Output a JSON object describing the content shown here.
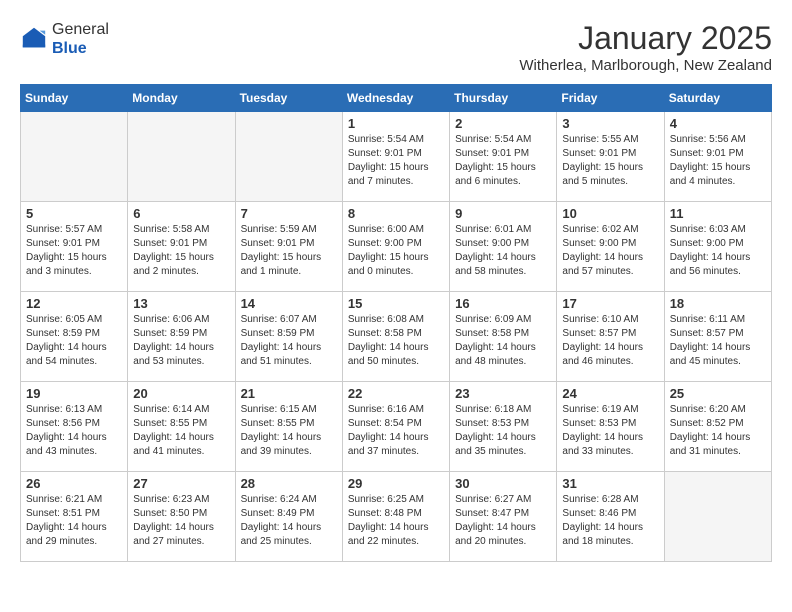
{
  "header": {
    "logo_general": "General",
    "logo_blue": "Blue",
    "month_title": "January 2025",
    "location": "Witherlea, Marlborough, New Zealand"
  },
  "days_of_week": [
    "Sunday",
    "Monday",
    "Tuesday",
    "Wednesday",
    "Thursday",
    "Friday",
    "Saturday"
  ],
  "weeks": [
    [
      {
        "day": "",
        "info": ""
      },
      {
        "day": "",
        "info": ""
      },
      {
        "day": "",
        "info": ""
      },
      {
        "day": "1",
        "info": "Sunrise: 5:54 AM\nSunset: 9:01 PM\nDaylight: 15 hours\nand 7 minutes."
      },
      {
        "day": "2",
        "info": "Sunrise: 5:54 AM\nSunset: 9:01 PM\nDaylight: 15 hours\nand 6 minutes."
      },
      {
        "day": "3",
        "info": "Sunrise: 5:55 AM\nSunset: 9:01 PM\nDaylight: 15 hours\nand 5 minutes."
      },
      {
        "day": "4",
        "info": "Sunrise: 5:56 AM\nSunset: 9:01 PM\nDaylight: 15 hours\nand 4 minutes."
      }
    ],
    [
      {
        "day": "5",
        "info": "Sunrise: 5:57 AM\nSunset: 9:01 PM\nDaylight: 15 hours\nand 3 minutes."
      },
      {
        "day": "6",
        "info": "Sunrise: 5:58 AM\nSunset: 9:01 PM\nDaylight: 15 hours\nand 2 minutes."
      },
      {
        "day": "7",
        "info": "Sunrise: 5:59 AM\nSunset: 9:01 PM\nDaylight: 15 hours\nand 1 minute."
      },
      {
        "day": "8",
        "info": "Sunrise: 6:00 AM\nSunset: 9:00 PM\nDaylight: 15 hours\nand 0 minutes."
      },
      {
        "day": "9",
        "info": "Sunrise: 6:01 AM\nSunset: 9:00 PM\nDaylight: 14 hours\nand 58 minutes."
      },
      {
        "day": "10",
        "info": "Sunrise: 6:02 AM\nSunset: 9:00 PM\nDaylight: 14 hours\nand 57 minutes."
      },
      {
        "day": "11",
        "info": "Sunrise: 6:03 AM\nSunset: 9:00 PM\nDaylight: 14 hours\nand 56 minutes."
      }
    ],
    [
      {
        "day": "12",
        "info": "Sunrise: 6:05 AM\nSunset: 8:59 PM\nDaylight: 14 hours\nand 54 minutes."
      },
      {
        "day": "13",
        "info": "Sunrise: 6:06 AM\nSunset: 8:59 PM\nDaylight: 14 hours\nand 53 minutes."
      },
      {
        "day": "14",
        "info": "Sunrise: 6:07 AM\nSunset: 8:59 PM\nDaylight: 14 hours\nand 51 minutes."
      },
      {
        "day": "15",
        "info": "Sunrise: 6:08 AM\nSunset: 8:58 PM\nDaylight: 14 hours\nand 50 minutes."
      },
      {
        "day": "16",
        "info": "Sunrise: 6:09 AM\nSunset: 8:58 PM\nDaylight: 14 hours\nand 48 minutes."
      },
      {
        "day": "17",
        "info": "Sunrise: 6:10 AM\nSunset: 8:57 PM\nDaylight: 14 hours\nand 46 minutes."
      },
      {
        "day": "18",
        "info": "Sunrise: 6:11 AM\nSunset: 8:57 PM\nDaylight: 14 hours\nand 45 minutes."
      }
    ],
    [
      {
        "day": "19",
        "info": "Sunrise: 6:13 AM\nSunset: 8:56 PM\nDaylight: 14 hours\nand 43 minutes."
      },
      {
        "day": "20",
        "info": "Sunrise: 6:14 AM\nSunset: 8:55 PM\nDaylight: 14 hours\nand 41 minutes."
      },
      {
        "day": "21",
        "info": "Sunrise: 6:15 AM\nSunset: 8:55 PM\nDaylight: 14 hours\nand 39 minutes."
      },
      {
        "day": "22",
        "info": "Sunrise: 6:16 AM\nSunset: 8:54 PM\nDaylight: 14 hours\nand 37 minutes."
      },
      {
        "day": "23",
        "info": "Sunrise: 6:18 AM\nSunset: 8:53 PM\nDaylight: 14 hours\nand 35 minutes."
      },
      {
        "day": "24",
        "info": "Sunrise: 6:19 AM\nSunset: 8:53 PM\nDaylight: 14 hours\nand 33 minutes."
      },
      {
        "day": "25",
        "info": "Sunrise: 6:20 AM\nSunset: 8:52 PM\nDaylight: 14 hours\nand 31 minutes."
      }
    ],
    [
      {
        "day": "26",
        "info": "Sunrise: 6:21 AM\nSunset: 8:51 PM\nDaylight: 14 hours\nand 29 minutes."
      },
      {
        "day": "27",
        "info": "Sunrise: 6:23 AM\nSunset: 8:50 PM\nDaylight: 14 hours\nand 27 minutes."
      },
      {
        "day": "28",
        "info": "Sunrise: 6:24 AM\nSunset: 8:49 PM\nDaylight: 14 hours\nand 25 minutes."
      },
      {
        "day": "29",
        "info": "Sunrise: 6:25 AM\nSunset: 8:48 PM\nDaylight: 14 hours\nand 22 minutes."
      },
      {
        "day": "30",
        "info": "Sunrise: 6:27 AM\nSunset: 8:47 PM\nDaylight: 14 hours\nand 20 minutes."
      },
      {
        "day": "31",
        "info": "Sunrise: 6:28 AM\nSunset: 8:46 PM\nDaylight: 14 hours\nand 18 minutes."
      },
      {
        "day": "",
        "info": ""
      }
    ]
  ]
}
